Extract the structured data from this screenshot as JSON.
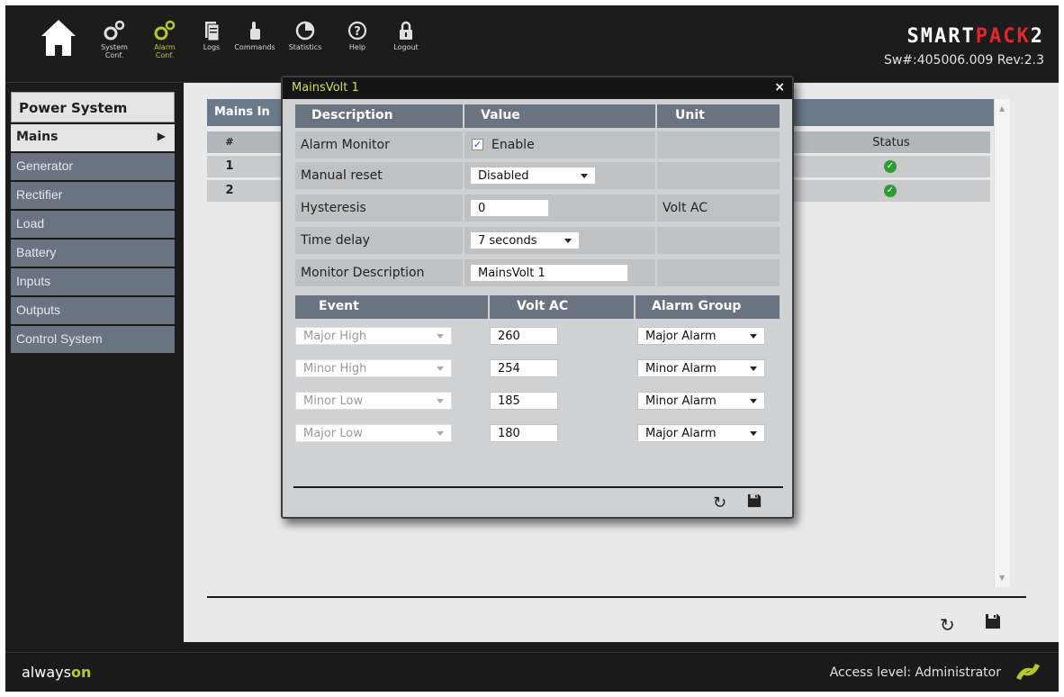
{
  "toolbar": {
    "items": [
      {
        "label": "System\nConf.",
        "icon": "gears-icon"
      },
      {
        "label": "Alarm\nConf.",
        "icon": "alarm-gears-icon"
      },
      {
        "label": "Logs",
        "icon": "logs-icon"
      },
      {
        "label": "Commands",
        "icon": "commands-icon"
      },
      {
        "label": "Statistics",
        "icon": "pie-chart-icon"
      },
      {
        "label": "Help",
        "icon": "help-icon"
      },
      {
        "label": "Logout",
        "icon": "lock-icon"
      }
    ],
    "active_color": "#b7c928"
  },
  "brand": {
    "logo_white": "SMART",
    "logo_red": "PACK",
    "logo_suffix": "2",
    "version": "Sw#:405006.009 Rev:2.3"
  },
  "sidebar": {
    "title": "Power System",
    "items": [
      {
        "label": "Mains",
        "selected": true
      },
      {
        "label": "Generator"
      },
      {
        "label": "Rectifier"
      },
      {
        "label": "Load"
      },
      {
        "label": "Battery"
      },
      {
        "label": "Inputs"
      },
      {
        "label": "Outputs"
      },
      {
        "label": "Control System"
      }
    ]
  },
  "main": {
    "header": "Mains In",
    "col_number": "#",
    "col_status": "Status",
    "rows": [
      {
        "number": "1",
        "status": "ok"
      },
      {
        "number": "2",
        "status": "ok"
      }
    ]
  },
  "dialog": {
    "title": "MainsVolt 1",
    "close": "×",
    "headers": {
      "description": "Description",
      "value": "Value",
      "unit": "Unit"
    },
    "alarm_monitor": {
      "label": "Alarm Monitor",
      "checked": true,
      "check_label": "Enable"
    },
    "manual_reset": {
      "label": "Manual reset",
      "value": "Disabled"
    },
    "hysteresis": {
      "label": "Hysteresis",
      "value": "0",
      "unit": "Volt AC"
    },
    "time_delay": {
      "label": "Time delay",
      "value": "7 seconds"
    },
    "monitor_description": {
      "label": "Monitor Description",
      "value": "MainsVolt 1"
    },
    "event_headers": {
      "event": "Event",
      "volt": "Volt AC",
      "group": "Alarm Group"
    },
    "events": [
      {
        "event": "Major High",
        "volt": "260",
        "group": "Major Alarm"
      },
      {
        "event": "Minor High",
        "volt": "254",
        "group": "Minor Alarm"
      },
      {
        "event": "Minor Low",
        "volt": "185",
        "group": "Minor Alarm"
      },
      {
        "event": "Major Low",
        "volt": "180",
        "group": "Major Alarm"
      }
    ]
  },
  "footer": {
    "brand_prefix": "always",
    "brand_suffix": "on",
    "access": "Access level: Administrator"
  },
  "colors": {
    "accent": "#b7c928",
    "header": "#6a7480",
    "ok": "#2e9b35",
    "logo_red": "#e1262d"
  }
}
